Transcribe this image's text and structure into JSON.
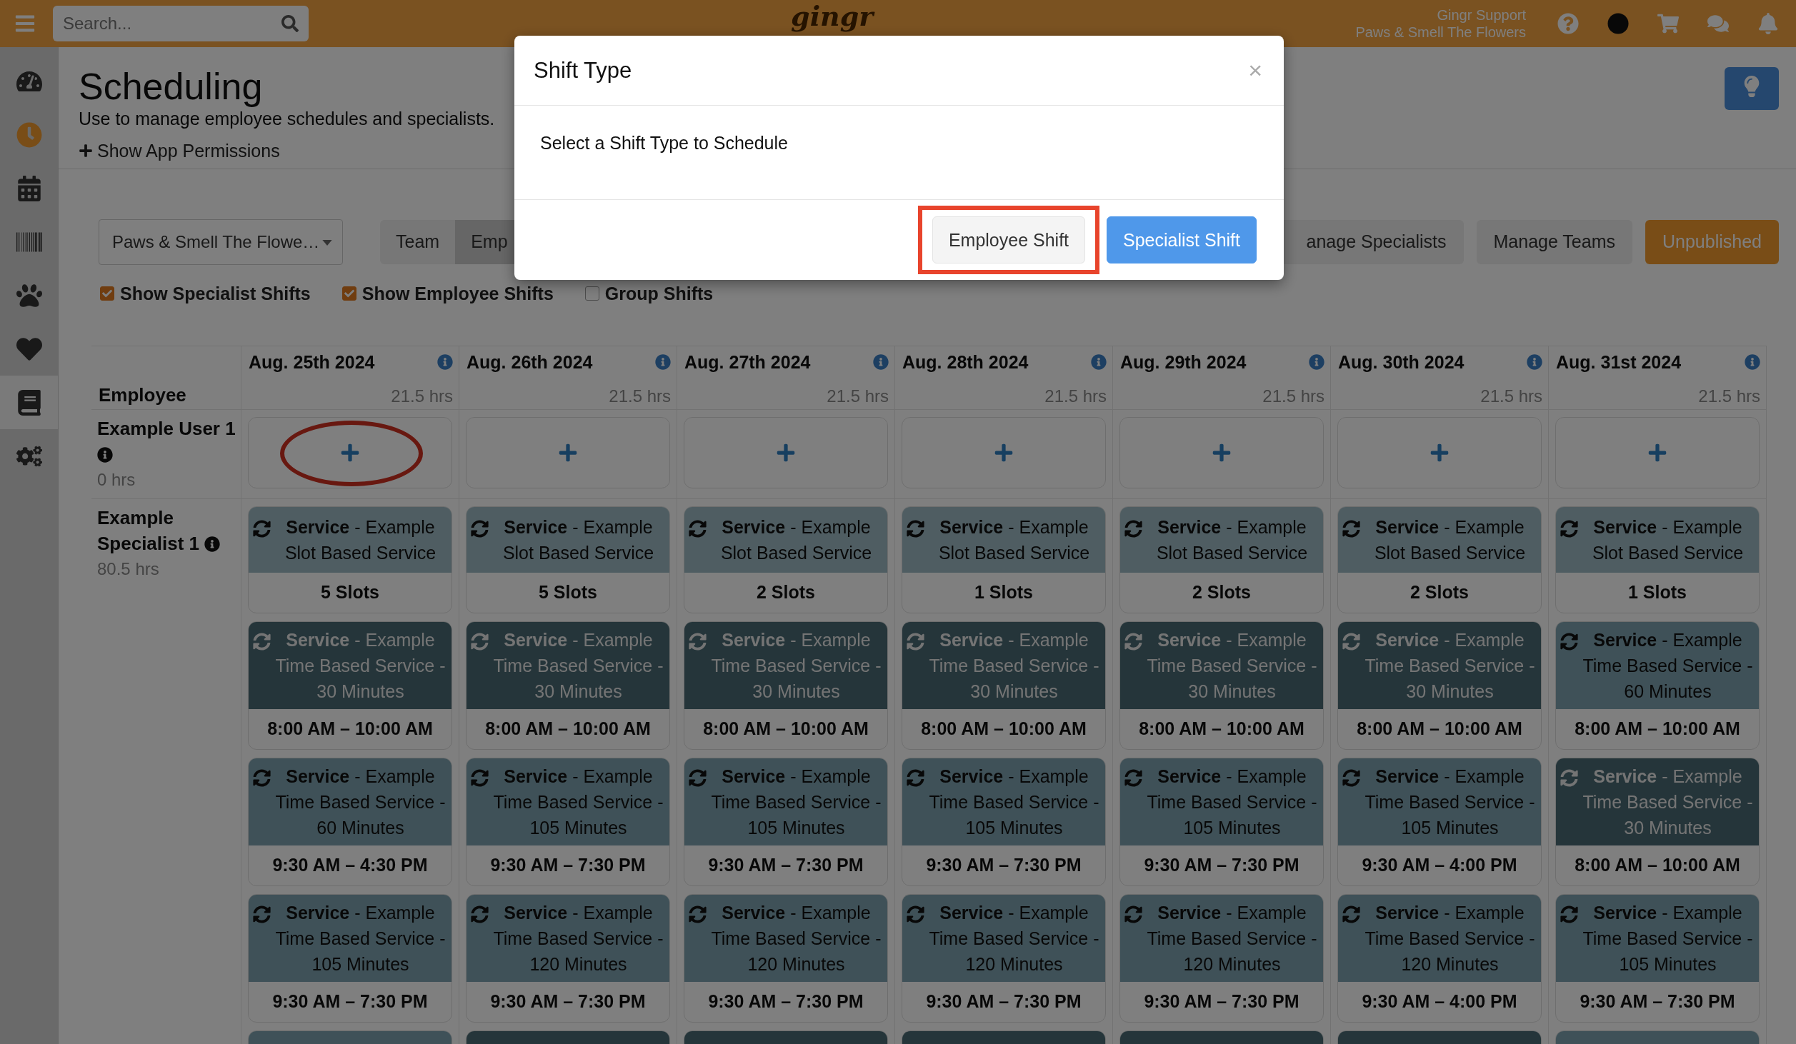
{
  "top_bar": {
    "search": {
      "placeholder": "Search..."
    },
    "logo": "gingr",
    "user": {
      "name": "Gingr Support",
      "location": "Paws & Smell The Flowers"
    }
  },
  "sidebar": {
    "items": [
      {
        "selected": false,
        "highlighted": false
      },
      {
        "selected": true,
        "highlighted": false
      },
      {
        "selected": false,
        "highlighted": false
      },
      {
        "selected": false,
        "highlighted": false
      },
      {
        "selected": false,
        "highlighted": false
      },
      {
        "selected": false,
        "highlighted": false
      },
      {
        "selected": false,
        "highlighted": true
      },
      {
        "selected": false,
        "highlighted": false
      }
    ]
  },
  "page": {
    "title": "Scheduling",
    "subtitle": "Use to manage employee schedules and specialists.",
    "permissions_link": "Show App Permissions"
  },
  "toolbar": {
    "location_select": "Paws & Smell The Flowe…",
    "view_tabs": [
      {
        "label": "Team",
        "selected": false
      },
      {
        "label": "Emp",
        "selected": true
      }
    ],
    "buttons": [
      {
        "label": "anage Specialists",
        "kind": "plain"
      },
      {
        "label": "Manage Teams",
        "kind": "plain"
      },
      {
        "label": "Unpublished",
        "kind": "warning"
      }
    ]
  },
  "filters": [
    {
      "label": "Show Specialist Shifts",
      "checked": true
    },
    {
      "label": "Show Employee Shifts",
      "checked": true
    },
    {
      "label": "Group Shifts",
      "checked": false
    }
  ],
  "schedule": {
    "employee_header": "Employee",
    "days": [
      {
        "date": "Aug. 25th 2024",
        "hours": "21.5 hrs"
      },
      {
        "date": "Aug. 26th 2024",
        "hours": "21.5 hrs"
      },
      {
        "date": "Aug. 27th 2024",
        "hours": "21.5 hrs"
      },
      {
        "date": "Aug. 28th 2024",
        "hours": "21.5 hrs"
      },
      {
        "date": "Aug. 29th 2024",
        "hours": "21.5 hrs"
      },
      {
        "date": "Aug. 30th 2024",
        "hours": "21.5 hrs"
      },
      {
        "date": "Aug. 31st 2024",
        "hours": "21.5 hrs"
      }
    ],
    "rows": [
      {
        "kind": "employee",
        "name": "Example User 1",
        "hours": "0 hrs",
        "cells": [
          {
            "highlighted": true
          },
          {
            "highlighted": false
          },
          {
            "highlighted": false
          },
          {
            "highlighted": false
          },
          {
            "highlighted": false
          },
          {
            "highlighted": false
          },
          {
            "highlighted": false
          }
        ]
      },
      {
        "kind": "specialist",
        "name": "Example Specialist 1",
        "hours": "80.5 hrs",
        "cells": [
          {
            "shifts": [
              {
                "kind": "slot",
                "title": "**Service** - Example Slot Based Service",
                "footer": "5 Slots"
              },
              {
                "kind": "dark",
                "title": "**Service** - Example Time Based Service - 30 Minutes",
                "footer": "8:00 AM – 10:00 AM"
              },
              {
                "kind": "medium",
                "title": "**Service** - Example Time Based Service - 60 Minutes",
                "footer": "9:30 AM – 4:30 PM"
              },
              {
                "kind": "medium",
                "title": "**Service** - Example Time Based Service - 105 Minutes",
                "footer": "9:30 AM – 7:30 PM"
              },
              {
                "kind": "medium"
              }
            ]
          },
          {
            "shifts": [
              {
                "kind": "slot",
                "title": "**Service** - Example Slot Based Service",
                "footer": "5 Slots"
              },
              {
                "kind": "dark",
                "title": "**Service** - Example Time Based Service - 30 Minutes",
                "footer": "8:00 AM – 10:00 AM"
              },
              {
                "kind": "medium",
                "title": "**Service** - Example Time Based Service - 105 Minutes",
                "footer": "9:30 AM – 7:30 PM"
              },
              {
                "kind": "medium",
                "title": "**Service** - Example Time Based Service - 120 Minutes",
                "footer": "9:30 AM – 7:30 PM"
              },
              {
                "kind": "dark"
              }
            ]
          },
          {
            "shifts": [
              {
                "kind": "slot",
                "title": "**Service** - Example Slot Based Service",
                "footer": "2 Slots"
              },
              {
                "kind": "dark",
                "title": "**Service** - Example Time Based Service - 30 Minutes",
                "footer": "8:00 AM – 10:00 AM"
              },
              {
                "kind": "medium",
                "title": "**Service** - Example Time Based Service - 105 Minutes",
                "footer": "9:30 AM – 7:30 PM"
              },
              {
                "kind": "medium",
                "title": "**Service** - Example Time Based Service - 120 Minutes",
                "footer": "9:30 AM – 7:30 PM"
              },
              {
                "kind": "dark"
              }
            ]
          },
          {
            "shifts": [
              {
                "kind": "slot",
                "title": "**Service** - Example Slot Based Service",
                "footer": "1 Slots"
              },
              {
                "kind": "dark",
                "title": "**Service** - Example Time Based Service - 30 Minutes",
                "footer": "8:00 AM – 10:00 AM"
              },
              {
                "kind": "medium",
                "title": "**Service** - Example Time Based Service - 105 Minutes",
                "footer": "9:30 AM – 7:30 PM"
              },
              {
                "kind": "medium",
                "title": "**Service** - Example Time Based Service - 120 Minutes",
                "footer": "9:30 AM – 7:30 PM"
              },
              {
                "kind": "dark"
              }
            ]
          },
          {
            "shifts": [
              {
                "kind": "slot",
                "title": "**Service** - Example Slot Based Service",
                "footer": "2 Slots"
              },
              {
                "kind": "dark",
                "title": "**Service** - Example Time Based Service - 30 Minutes",
                "footer": "8:00 AM – 10:00 AM"
              },
              {
                "kind": "medium",
                "title": "**Service** - Example Time Based Service - 105 Minutes",
                "footer": "9:30 AM – 7:30 PM"
              },
              {
                "kind": "medium",
                "title": "**Service** - Example Time Based Service - 120 Minutes",
                "footer": "9:30 AM – 7:30 PM"
              },
              {
                "kind": "dark"
              }
            ]
          },
          {
            "shifts": [
              {
                "kind": "slot",
                "title": "**Service** - Example Slot Based Service",
                "footer": "2 Slots"
              },
              {
                "kind": "dark",
                "title": "**Service** - Example Time Based Service - 30 Minutes",
                "footer": "8:00 AM – 10:00 AM"
              },
              {
                "kind": "medium",
                "title": "**Service** - Example Time Based Service - 105 Minutes",
                "footer": "9:30 AM – 4:00 PM"
              },
              {
                "kind": "medium",
                "title": "**Service** - Example Time Based Service - 120 Minutes",
                "footer": "9:30 AM – 4:00 PM"
              },
              {
                "kind": "dark"
              }
            ]
          },
          {
            "shifts": [
              {
                "kind": "slot",
                "title": "**Service** - Example Slot Based Service",
                "footer": "1 Slots"
              },
              {
                "kind": "medium",
                "title": "**Service** - Example Time Based Service - 60 Minutes",
                "footer": "8:00 AM – 10:00 AM"
              },
              {
                "kind": "dark",
                "title": "**Service** - Example Time Based Service - 30 Minutes",
                "footer": "8:00 AM – 10:00 AM"
              },
              {
                "kind": "medium",
                "title": "**Service** - Example Time Based Service - 105 Minutes",
                "footer": "9:30 AM – 7:30 PM"
              },
              {
                "kind": "medium"
              }
            ]
          }
        ]
      }
    ]
  },
  "modal": {
    "title": "Shift Type",
    "close": "×",
    "message": "Select a Shift Type to Schedule",
    "buttons": [
      {
        "label": "Employee Shift",
        "kind": "default",
        "highlighted": true
      },
      {
        "label": "Specialist Shift",
        "kind": "primary",
        "highlighted": false
      }
    ]
  }
}
